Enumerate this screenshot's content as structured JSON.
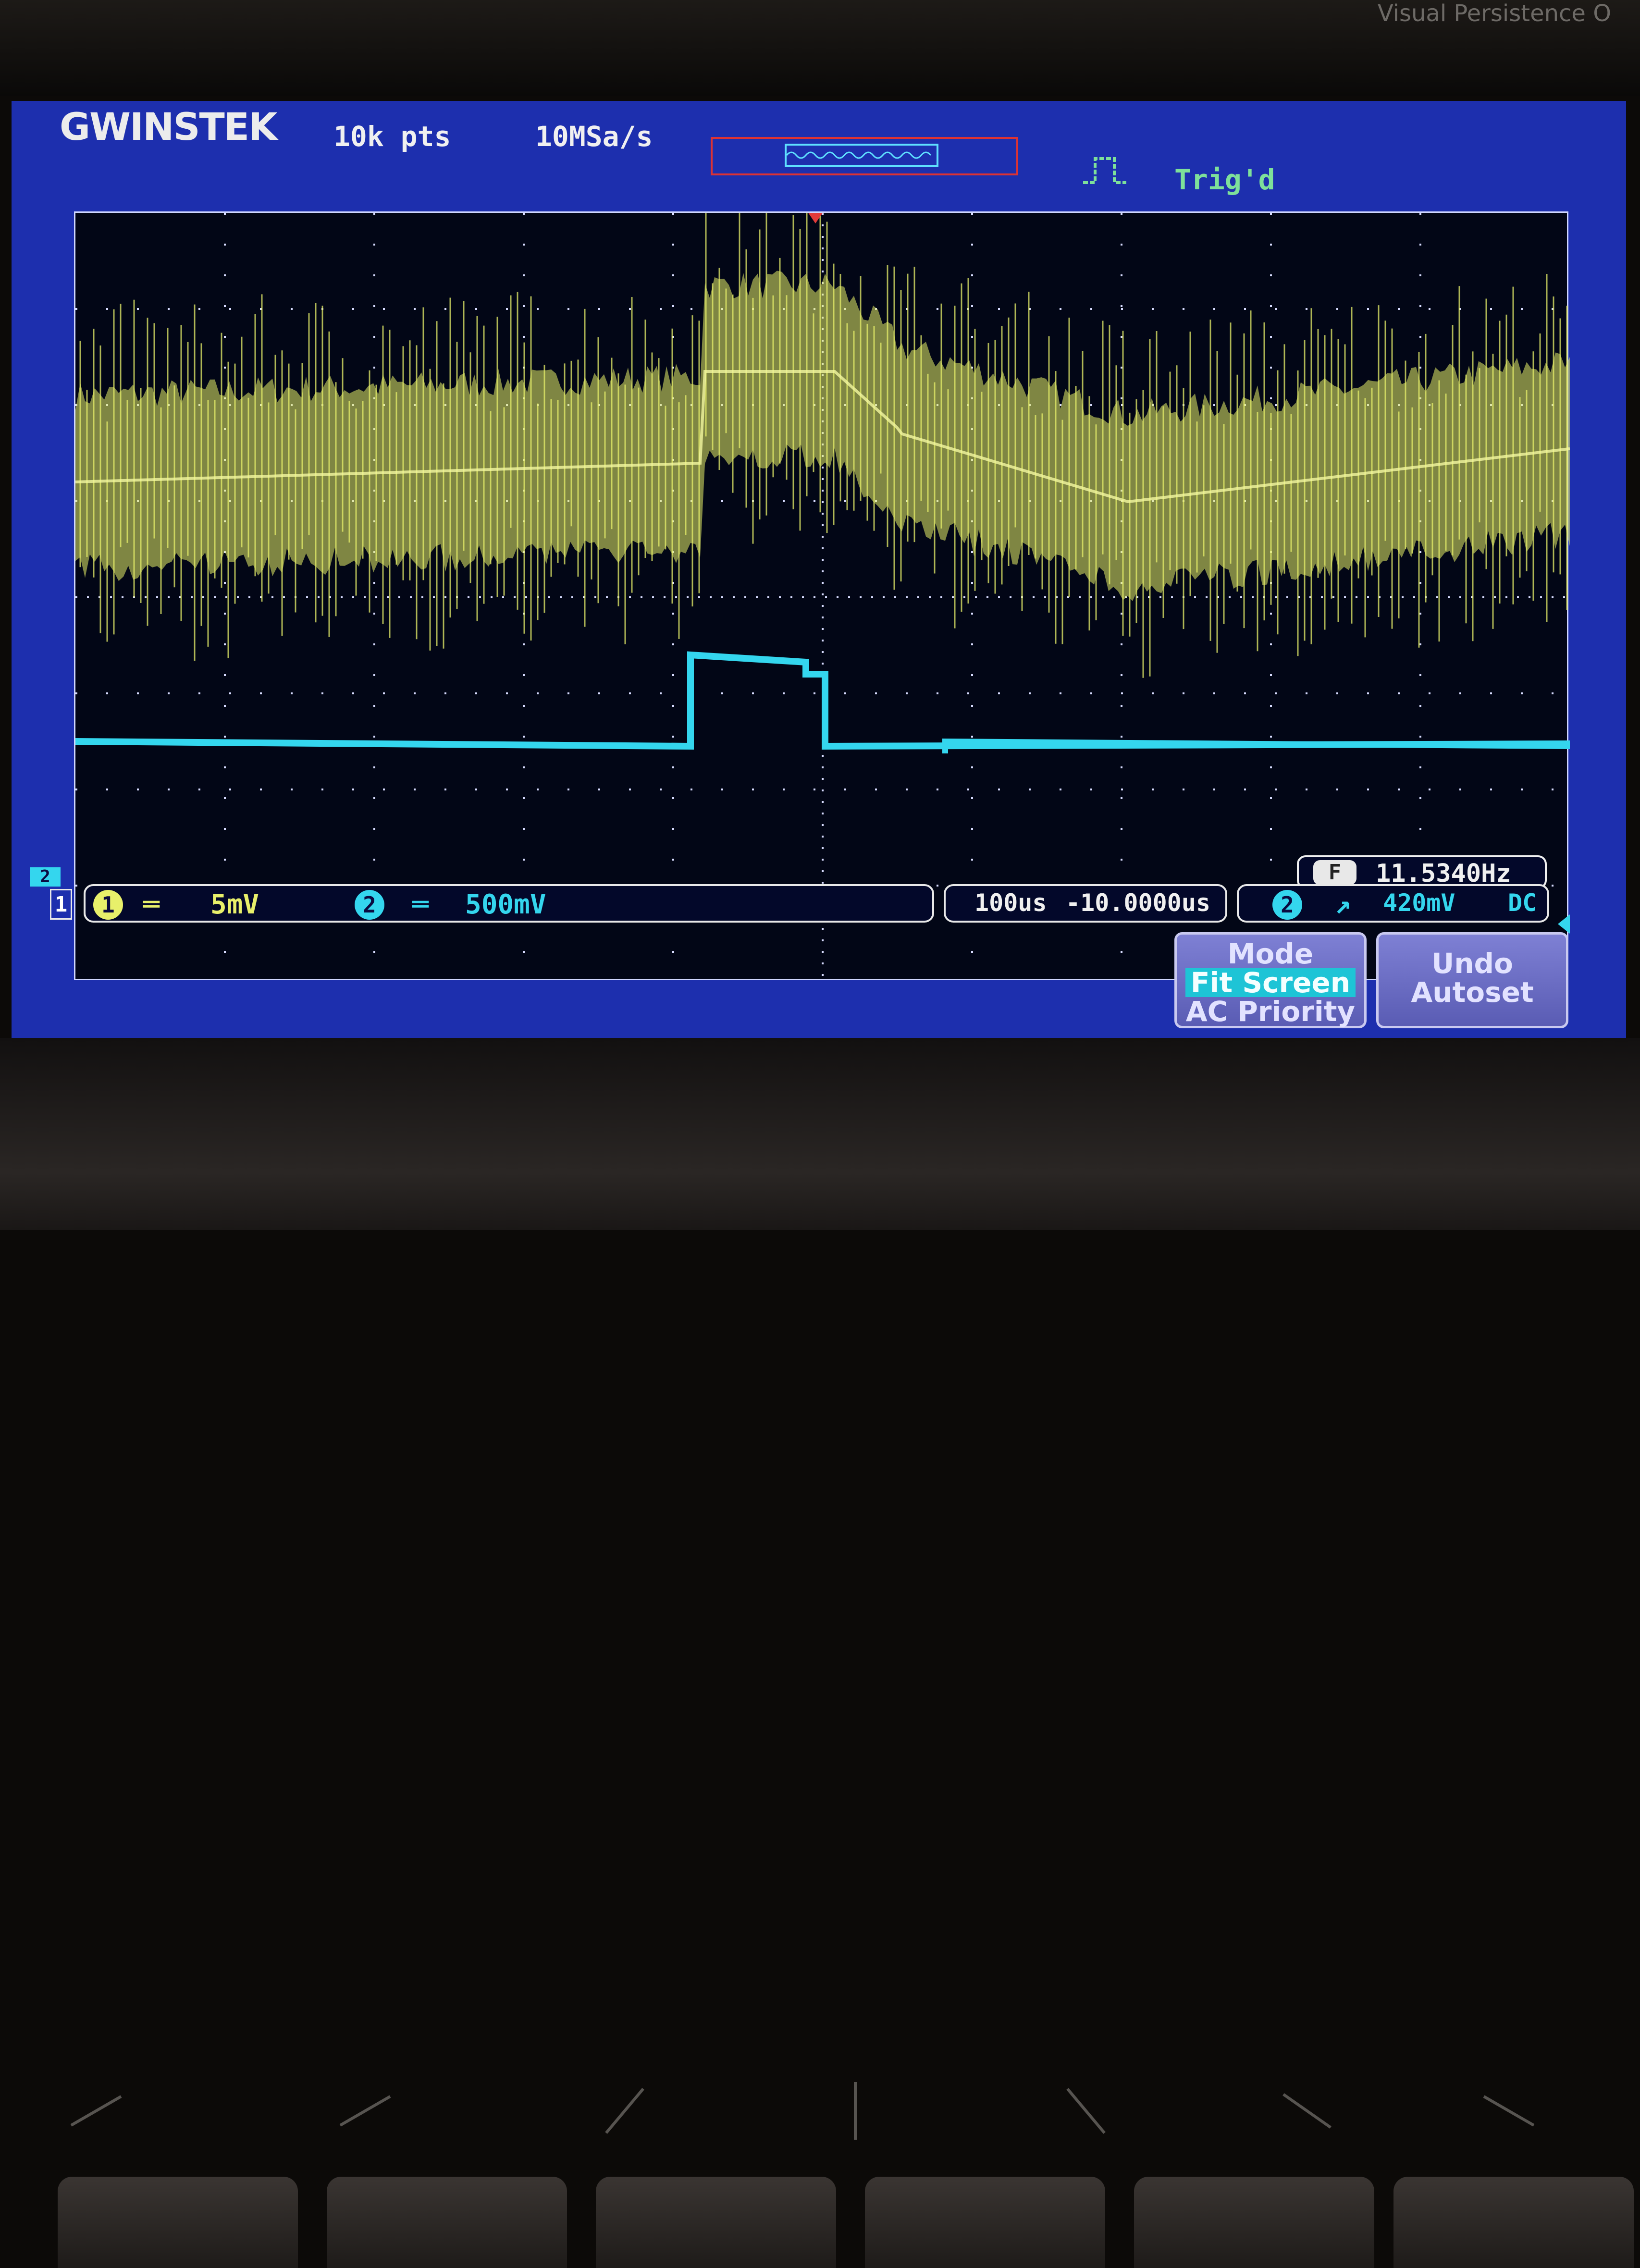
{
  "bezel": {
    "label": "Visual Persistence O"
  },
  "header": {
    "brand": "GWINSTEK",
    "record_length": "10k pts",
    "sample_rate": "10MSa/s",
    "trigger_status": "Trig'd"
  },
  "channels": {
    "ch1": {
      "number": "1",
      "coupling_icon": "dc-coupling-icon",
      "scale": "5mV",
      "color": "#e8f06a"
    },
    "ch2": {
      "number": "2",
      "coupling_icon": "dc-coupling-icon",
      "scale": "500mV",
      "color": "#34d6ee"
    },
    "ch2_marker": "2",
    "ch1_marker": "1"
  },
  "timebase": {
    "scale": "100us",
    "position": "-10.0000us"
  },
  "trigger": {
    "source": "2",
    "slope_icon": "rising-edge-icon",
    "level": "420mV",
    "coupling": "DC"
  },
  "frequency": {
    "label": "F",
    "value": "11.5340Hz"
  },
  "menu": {
    "mode": {
      "title": "Mode",
      "options": [
        "Fit Screen",
        "AC Priority"
      ],
      "selected": "Fit Screen"
    },
    "undo": {
      "line1": "Undo",
      "line2": "Autoset"
    }
  },
  "colors": {
    "screen_bg": "#1d2fae",
    "ch1": "#e8f06a",
    "ch2": "#34d6ee",
    "trigger_marker": "#e23a3a"
  }
}
